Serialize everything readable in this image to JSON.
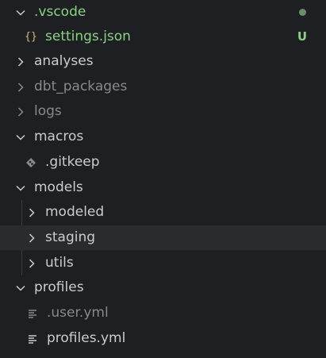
{
  "explorer": {
    "items": [
      {
        "label": ".vscode",
        "type": "folder",
        "expanded": true,
        "git_status": "dot"
      },
      {
        "label": "settings.json",
        "type": "json-file",
        "git_status": "U"
      },
      {
        "label": "analyses",
        "type": "folder",
        "expanded": false
      },
      {
        "label": "dbt_packages",
        "type": "folder",
        "expanded": false,
        "dimmed": true
      },
      {
        "label": "logs",
        "type": "folder",
        "expanded": false,
        "dimmed": true
      },
      {
        "label": "macros",
        "type": "folder",
        "expanded": true
      },
      {
        "label": ".gitkeep",
        "type": "git-file"
      },
      {
        "label": "models",
        "type": "folder",
        "expanded": true
      },
      {
        "label": "modeled",
        "type": "folder",
        "expanded": false
      },
      {
        "label": "staging",
        "type": "folder",
        "expanded": false,
        "hovered": true
      },
      {
        "label": "utils",
        "type": "folder",
        "expanded": false
      },
      {
        "label": "profiles",
        "type": "folder",
        "expanded": true
      },
      {
        "label": ".user.yml",
        "type": "yml-file",
        "dimmed": true
      },
      {
        "label": "profiles.yml",
        "type": "yml-file"
      }
    ]
  },
  "colors": {
    "background": "#1e1f22",
    "text": "#cccccc",
    "dimmed": "#8a8a8a",
    "untracked": "#89d185",
    "json_icon": "#d7ba7d",
    "hover_row": "#2a2b2e"
  },
  "icons": {
    "expanded": "chevron-down-icon",
    "collapsed": "chevron-right-icon",
    "json": "json-braces-icon",
    "git": "git-diamond-icon",
    "yml": "lines-icon"
  },
  "git_status_letter": "U"
}
